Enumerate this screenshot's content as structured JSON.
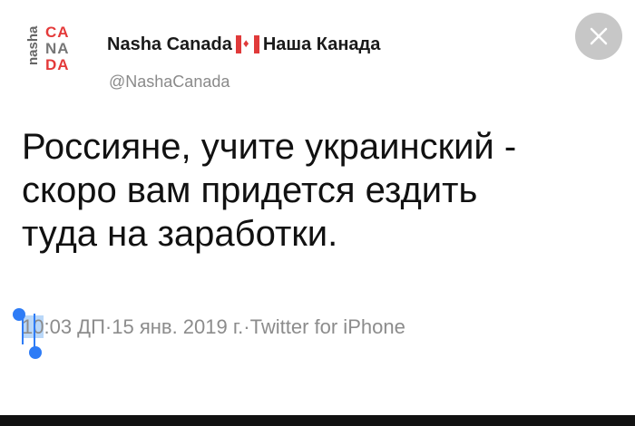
{
  "header": {
    "logo_side_text": "nasha",
    "logo_rows": [
      "CA",
      "NA",
      "DA"
    ],
    "display_name_left": "Nasha Canada",
    "display_name_right": "Наша Канада",
    "handle": "@NashaCanada"
  },
  "tweet": {
    "lines": [
      "Россияне, учите украинский -",
      "скоро вам придется ездить",
      "туда на заработки."
    ]
  },
  "meta": {
    "time_selected_part": "10",
    "time_rest": ":03 ДП",
    "separator": " · ",
    "date": "15 янв. 2019 г.",
    "source": "Twitter for iPhone"
  },
  "colors": {
    "accent_blue": "#2e7cf6",
    "flag_red": "#e03a3a",
    "logo_red": "#e43a3a"
  },
  "icons": {
    "close": "close-icon",
    "flag": "canada-flag-icon"
  }
}
